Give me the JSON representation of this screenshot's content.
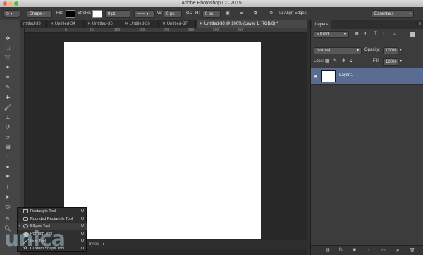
{
  "app": {
    "title": "Adobe Photoshop CC 2015"
  },
  "colors": {
    "traffic_red": "#fc605c",
    "traffic_yellow": "#fdbc40",
    "traffic_green": "#34c84a",
    "selected_layer": "#5a6c91"
  },
  "options": {
    "mode": "Shape",
    "fill_label": "Fill:",
    "stroke_label": "Stroke:",
    "stroke_size": "8 pt",
    "w_label": "W:",
    "w_value": "0 px",
    "link_label": "GO",
    "h_label": "H:",
    "h_value": "0 px",
    "align_edges": "Align Edges",
    "workspace": "Essentials"
  },
  "tabs": [
    {
      "label": "ntitled-33"
    },
    {
      "label": "Untitled-34"
    },
    {
      "label": "Untitled-35"
    },
    {
      "label": "Untitled-36"
    },
    {
      "label": "Untitled-37"
    },
    {
      "label": "Untitled-38 @ 100% (Layer 1, RGB/8) *"
    }
  ],
  "ruler": {
    "top_marks": [
      "0",
      "50",
      "100",
      "150",
      "200",
      "250",
      "300",
      "350"
    ]
  },
  "tools": [
    "move-icon",
    "marquee-icon",
    "lasso-icon",
    "quick-select-icon",
    "crop-icon",
    "eyedropper-icon",
    "healing-icon",
    "brush-icon",
    "clone-stamp-icon",
    "history-brush-icon",
    "eraser-icon",
    "gradient-icon",
    "blur-icon",
    "dodge-icon",
    "pen-icon",
    "type-icon",
    "path-select-icon",
    "shape-icon",
    "hand-icon",
    "zoom-icon"
  ],
  "flyout": [
    {
      "label": "Rectangle Tool",
      "key": "U"
    },
    {
      "label": "Rounded Rectangle Tool",
      "key": "U"
    },
    {
      "label": "Ellipse Tool",
      "key": "U"
    },
    {
      "label": "Polygon Tool",
      "key": "U"
    },
    {
      "label": "Line Tool",
      "key": "U"
    },
    {
      "label": "Custom Shape Tool",
      "key": "U"
    }
  ],
  "status": {
    "text": "bytes"
  },
  "layers_panel": {
    "tab": "Layers",
    "kind": "Kind",
    "blend_mode": "Normal",
    "opacity_label": "Opacity:",
    "opacity_value": "100%",
    "lock_label": "Lock:",
    "fill_label": "Fill:",
    "fill_value": "100%",
    "layer_name": "Layer 1",
    "bottom_icons": [
      "link-icon",
      "fx-icon",
      "mask-icon",
      "adjustment-icon",
      "group-icon",
      "new-layer-icon",
      "trash-icon"
    ]
  },
  "watermark": "unica"
}
